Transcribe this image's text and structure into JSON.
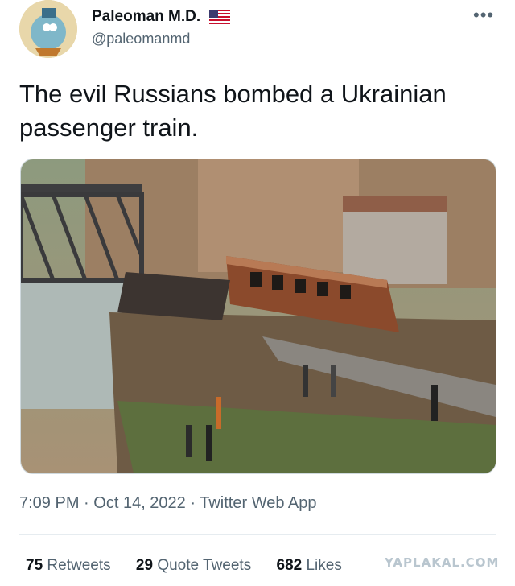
{
  "author": {
    "display_name": "Paleoman M.D.",
    "handle": "@paleomanmd",
    "flag_icon": "us-flag-icon",
    "avatar_icon": "avatar-icon"
  },
  "more_label": "•••",
  "tweet": {
    "text": "The evil Russians bombed a Ukrainian passenger train."
  },
  "meta": {
    "time": "7:09 PM",
    "sep1": "·",
    "date": "Oct 14, 2022",
    "sep2": "·",
    "client": "Twitter Web App"
  },
  "stats": {
    "retweets_count": "75",
    "retweets_label": "Retweets",
    "quotes_count": "29",
    "quotes_label": "Quote Tweets",
    "likes_count": "682",
    "likes_label": "Likes"
  },
  "watermark": "YAPLAKAL.COM",
  "colors": {
    "text": "#0f1419",
    "secondary": "#536471",
    "divider": "#e6ecf0"
  }
}
